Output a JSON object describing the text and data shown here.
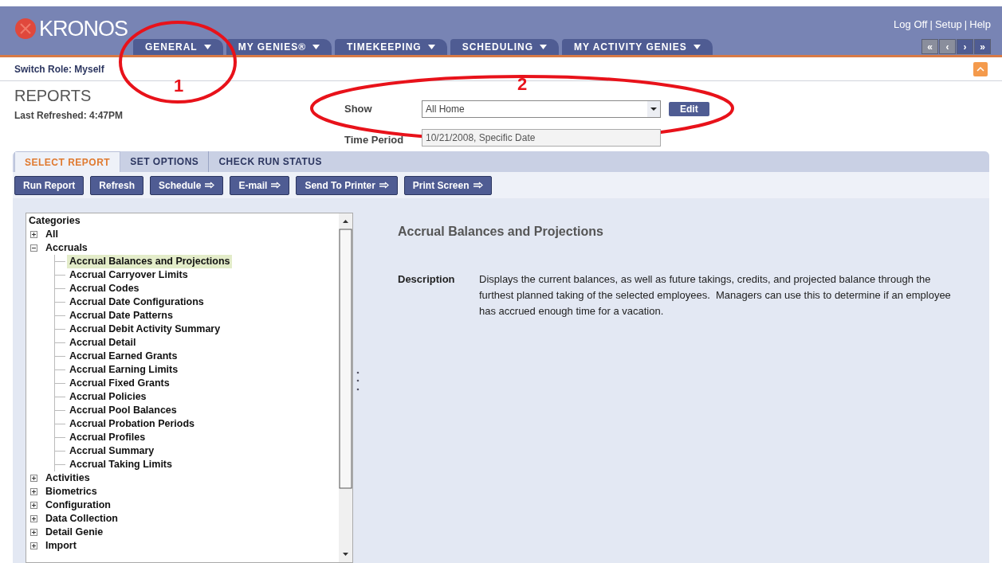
{
  "header": {
    "logo": "KRONOS",
    "links": [
      "Log Off",
      "Setup",
      "Help"
    ],
    "link_separator": "|",
    "tabs": [
      {
        "label": "GENERAL",
        "selected": false
      },
      {
        "label": "MY GENIES®",
        "selected": false
      },
      {
        "label": "TIMEKEEPING",
        "selected": false
      },
      {
        "label": "SCHEDULING",
        "selected": false
      },
      {
        "label": "MY ACTIVITY GENIES",
        "selected": false
      }
    ],
    "nav_buttons": [
      "«",
      "‹",
      "›",
      "»"
    ]
  },
  "switch_role": "Switch Role: Myself",
  "page": {
    "title": "REPORTS",
    "last_refreshed": "Last Refreshed: 4:47PM"
  },
  "filters": {
    "show_label": "Show",
    "show_value": "All Home",
    "edit": "Edit",
    "period_label": "Time Period",
    "period_value": "10/21/2008, Specific Date"
  },
  "subtabs": [
    {
      "label": "SELECT REPORT",
      "selected": true
    },
    {
      "label": "SET OPTIONS",
      "selected": false
    },
    {
      "label": "CHECK RUN STATUS",
      "selected": false
    }
  ],
  "toolbar": [
    {
      "label": "Run Report",
      "arrow": false
    },
    {
      "label": "Refresh",
      "arrow": false
    },
    {
      "label": "Schedule",
      "arrow": true
    },
    {
      "label": "E-mail",
      "arrow": true
    },
    {
      "label": "Send To Printer",
      "arrow": true
    },
    {
      "label": "Print Screen",
      "arrow": true
    }
  ],
  "tree": {
    "title": "Categories",
    "items": [
      {
        "label": "All",
        "expanded": false
      },
      {
        "label": "Accruals",
        "expanded": true,
        "children": [
          {
            "label": "Accrual Balances and Projections",
            "selected": true
          },
          {
            "label": "Accrual Carryover Limits",
            "selected": false
          },
          {
            "label": "Accrual Codes",
            "selected": false
          },
          {
            "label": "Accrual Date Configurations",
            "selected": false
          },
          {
            "label": "Accrual Date Patterns",
            "selected": false
          },
          {
            "label": "Accrual Debit Activity Summary",
            "selected": false
          },
          {
            "label": "Accrual Detail",
            "selected": false
          },
          {
            "label": "Accrual Earned Grants",
            "selected": false
          },
          {
            "label": "Accrual Earning Limits",
            "selected": false
          },
          {
            "label": "Accrual Fixed Grants",
            "selected": false
          },
          {
            "label": "Accrual Policies",
            "selected": false
          },
          {
            "label": "Accrual Pool Balances",
            "selected": false
          },
          {
            "label": "Accrual Probation Periods",
            "selected": false
          },
          {
            "label": "Accrual Profiles",
            "selected": false
          },
          {
            "label": "Accrual Summary",
            "selected": false
          },
          {
            "label": "Accrual Taking Limits",
            "selected": false
          }
        ]
      },
      {
        "label": "Activities",
        "expanded": false
      },
      {
        "label": "Biometrics",
        "expanded": false
      },
      {
        "label": "Configuration",
        "expanded": false
      },
      {
        "label": "Data Collection",
        "expanded": false
      },
      {
        "label": "Detail Genie",
        "expanded": false
      },
      {
        "label": "Import",
        "expanded": false
      }
    ]
  },
  "detail": {
    "title": "Accrual Balances and Projections",
    "description_label": "Description",
    "description": "Displays the current balances, as well as future takings, credits, and projected balance through the furthest planned taking of the selected employees.  Managers can use this to determine if an employee has accrued enough time for a vacation."
  },
  "annotations": [
    "1",
    "2"
  ]
}
